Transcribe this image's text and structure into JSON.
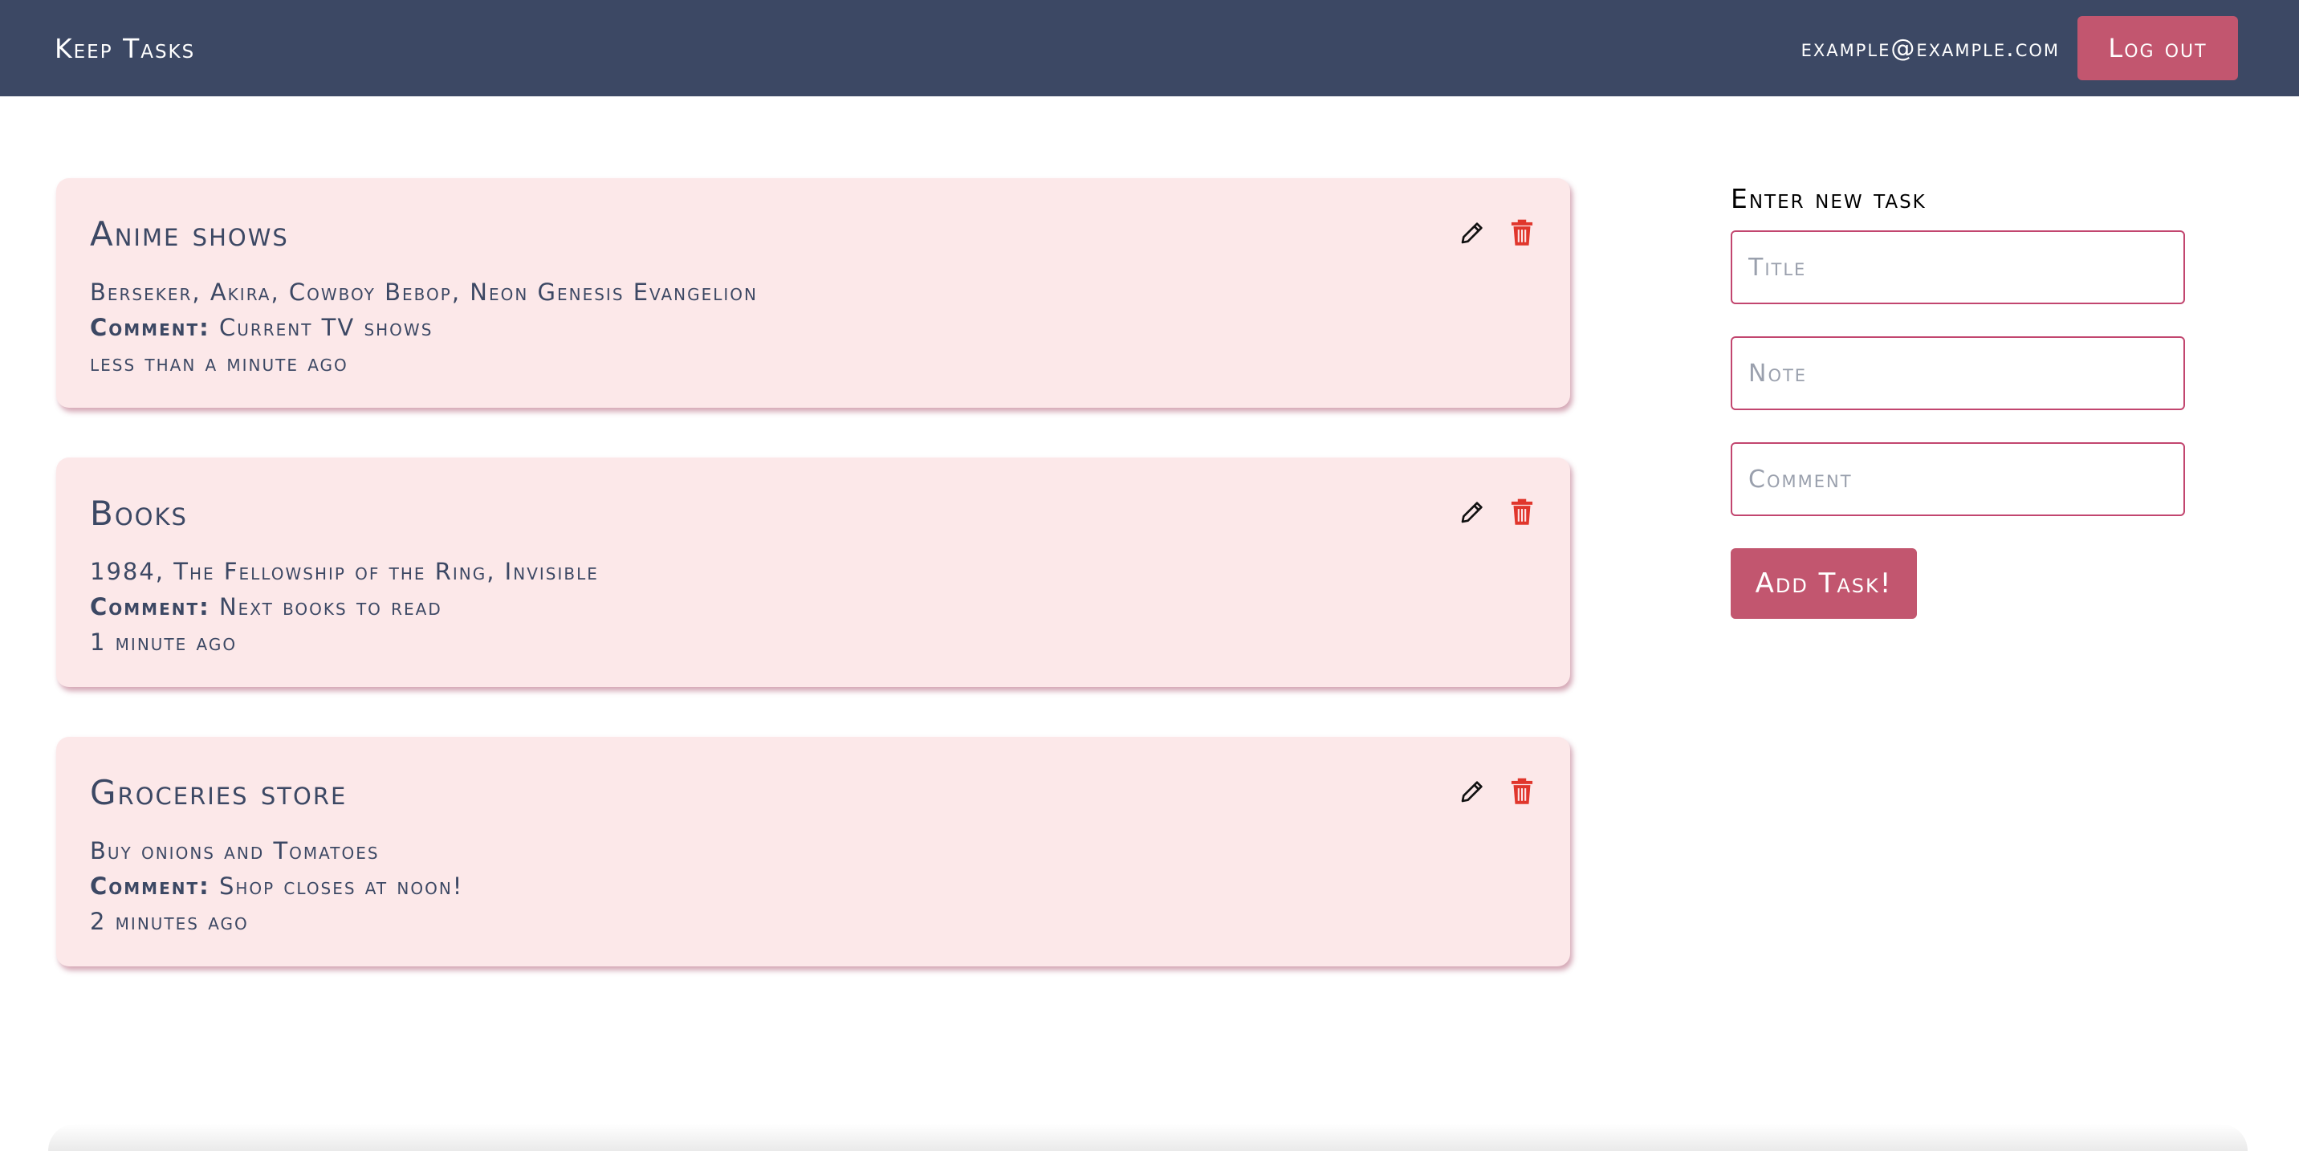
{
  "navbar": {
    "brand": "Keep Tasks",
    "user_email": "example@example.com",
    "logout_label": "Log out"
  },
  "tasks": [
    {
      "title": "Anime shows",
      "note": "Berseker, Akira, Cowboy Bebop, Neon Genesis Evangelion",
      "comment_label": "Comment:",
      "comment": "Current TV shows",
      "time": "less than a minute ago"
    },
    {
      "title": "Books",
      "note": "1984, The Fellowship of the Ring, Invisible",
      "comment_label": "Comment:",
      "comment": "Next books to read",
      "time": "1 minute ago"
    },
    {
      "title": "Groceries store",
      "note": "Buy onions and Tomatoes",
      "comment_label": "Comment:",
      "comment": "Shop closes at noon!",
      "time": "2 minutes ago"
    }
  ],
  "new_task": {
    "heading": "Enter new task",
    "title_placeholder": "Title",
    "note_placeholder": "Note",
    "comment_placeholder": "Comment",
    "submit_label": "Add Task!"
  },
  "icons": {
    "edit": "pencil-icon",
    "delete": "trash-icon"
  },
  "colors": {
    "navbar_bg": "#3c4864",
    "accent": "#c2566f",
    "card_bg": "#fce8e9",
    "delete_icon": "#e0362c"
  }
}
